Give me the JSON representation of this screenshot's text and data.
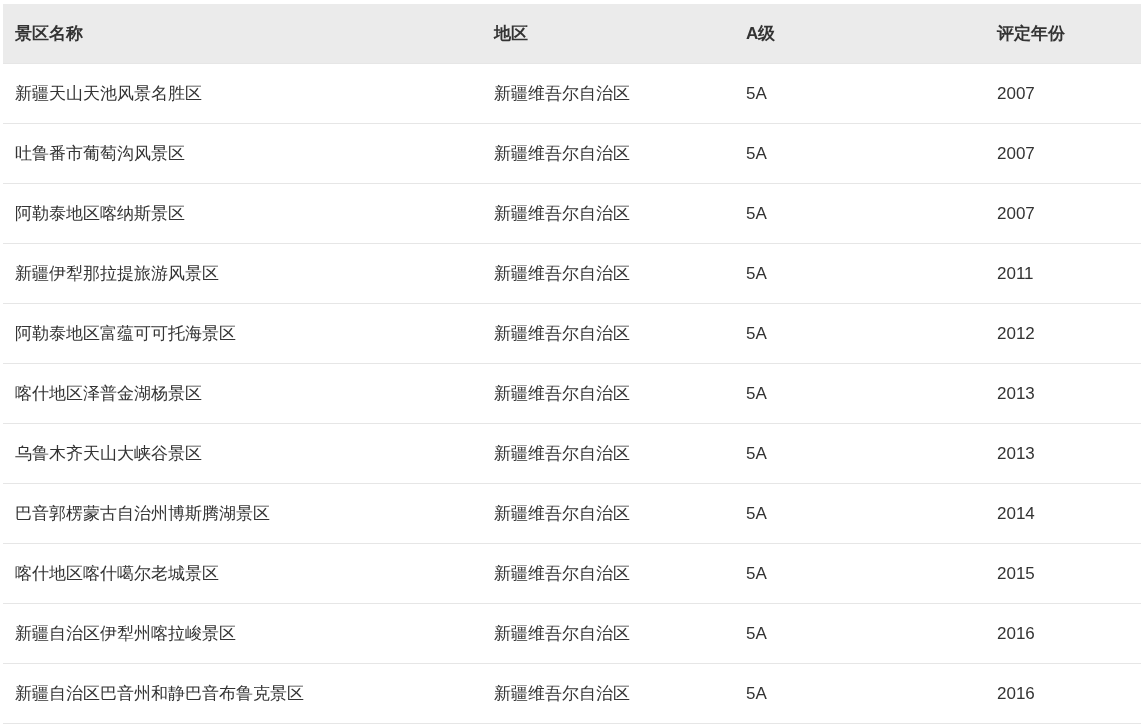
{
  "table": {
    "columns": [
      "景区名称",
      "地区",
      "A级",
      "评定年份"
    ],
    "rows": [
      [
        "新疆天山天池风景名胜区",
        "新疆维吾尔自治区",
        "5A",
        "2007"
      ],
      [
        "吐鲁番市葡萄沟风景区",
        "新疆维吾尔自治区",
        "5A",
        "2007"
      ],
      [
        "阿勒泰地区喀纳斯景区",
        "新疆维吾尔自治区",
        "5A",
        "2007"
      ],
      [
        "新疆伊犁那拉提旅游风景区",
        "新疆维吾尔自治区",
        "5A",
        "2011"
      ],
      [
        "阿勒泰地区富蕴可可托海景区",
        "新疆维吾尔自治区",
        "5A",
        "2012"
      ],
      [
        "喀什地区泽普金湖杨景区",
        "新疆维吾尔自治区",
        "5A",
        "2013"
      ],
      [
        "乌鲁木齐天山大峡谷景区",
        "新疆维吾尔自治区",
        "5A",
        "2013"
      ],
      [
        "巴音郭楞蒙古自治州博斯腾湖景区",
        "新疆维吾尔自治区",
        "5A",
        "2014"
      ],
      [
        "喀什地区喀什噶尔老城景区",
        "新疆维吾尔自治区",
        "5A",
        "2015"
      ],
      [
        "新疆自治区伊犁州喀拉峻景区",
        "新疆维吾尔自治区",
        "5A",
        "2016"
      ],
      [
        "新疆自治区巴音州和静巴音布鲁克景区",
        "新疆维吾尔自治区",
        "5A",
        "2016"
      ]
    ]
  }
}
